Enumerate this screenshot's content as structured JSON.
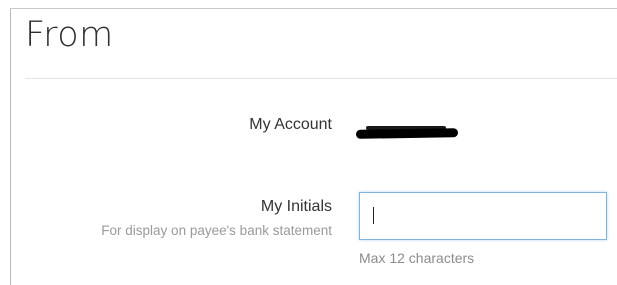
{
  "section": {
    "title": "From"
  },
  "account": {
    "label": "My Account",
    "value": "[redacted]"
  },
  "initials": {
    "label": "My Initials",
    "helper": "For display on payee's bank statement",
    "value": "",
    "placeholder": "",
    "note": "Max 12 characters",
    "focus_color": "#7fb2dc"
  }
}
